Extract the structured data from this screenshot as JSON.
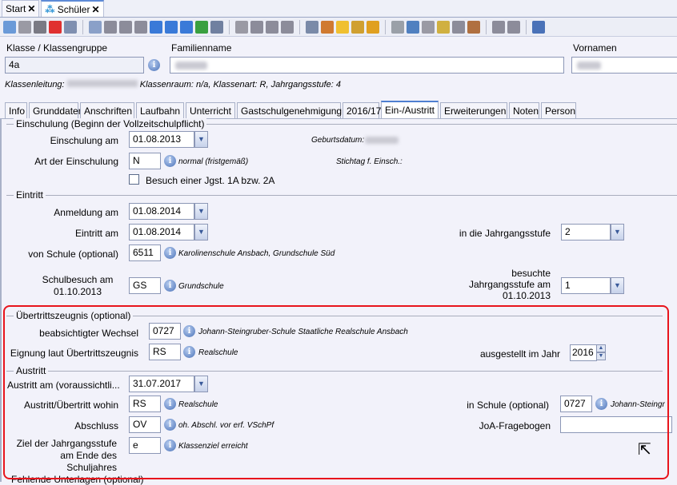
{
  "doc_tabs": [
    {
      "label": "Start"
    },
    {
      "label": "Schüler"
    }
  ],
  "toolbar_icons": [
    "new-icon",
    "save-icon",
    "undo-icon",
    "delete-icon",
    "form-icon",
    "|",
    "list-icon",
    "first-icon",
    "prev-page-icon",
    "prev-icon",
    "next-icon",
    "next-page-icon",
    "last-icon",
    "refresh-icon",
    "details-icon",
    "|",
    "back-icon",
    "cut-icon",
    "copy-icon",
    "paste-icon",
    "|",
    "print-icon",
    "view-icon",
    "tip-icon",
    "bell-icon",
    "clock-icon",
    "|",
    "export-icon",
    "user-icon",
    "tb-icon",
    "import-icon",
    "book-icon",
    "contact-icon",
    "|",
    "upload-icon",
    "download-icon",
    "|",
    "help-icon"
  ],
  "toolbar_colors": {
    "new-icon": "#6a9ad8",
    "save-icon": "#9a9aa4",
    "undo-icon": "#7a7a84",
    "delete-icon": "#e03030",
    "form-icon": "#7f8fb0",
    "list-icon": "#8aa0c8",
    "first-icon": "#8c8c9a",
    "prev-page-icon": "#8c8c9a",
    "prev-icon": "#8c8c9a",
    "next-icon": "#3a7ad8",
    "next-page-icon": "#3a7ad8",
    "last-icon": "#3a7ad8",
    "refresh-icon": "#3aa040",
    "details-icon": "#7080a0",
    "back-icon": "#9a9aa4",
    "cut-icon": "#8c8c9a",
    "copy-icon": "#8c8c9a",
    "paste-icon": "#8c8c9a",
    "print-icon": "#7a8aa8",
    "view-icon": "#d07a30",
    "tip-icon": "#f0c030",
    "bell-icon": "#d0a030",
    "clock-icon": "#e0a020",
    "export-icon": "#9aa0a8",
    "user-icon": "#5080c0",
    "tb-icon": "#9a9aa4",
    "import-icon": "#d0b040",
    "book-icon": "#8c8c9a",
    "contact-icon": "#b07040",
    "upload-icon": "#8c8c9a",
    "download-icon": "#8c8c9a",
    "help-icon": "#4a72b8"
  },
  "header": {
    "klasse_label": "Klasse / Klassengruppe",
    "klasse_value": "4a",
    "familienname_label": "Familienname",
    "vornamen_label": "Vornamen",
    "info_line_prefix": "Klassenleitung:",
    "info_line_rest": "Klassenraum: n/a, Klassenart: R, Jahrgangsstufe: 4"
  },
  "tabs": [
    {
      "label": "Info"
    },
    {
      "label": "Grunddaten"
    },
    {
      "label": "Anschriften"
    },
    {
      "label": "Laufbahn"
    },
    {
      "label": "Unterricht"
    },
    {
      "label": "Gastschulgenehmigung"
    },
    {
      "label": "2016/17"
    },
    {
      "label": "Ein-/Austritt",
      "active": true
    },
    {
      "label": "Erweiterungen"
    },
    {
      "label": "Noten"
    },
    {
      "label": "Person"
    }
  ],
  "einschulung": {
    "legend": "Einschulung (Beginn der Vollzeitschulpflicht)",
    "am_label": "Einschulung am",
    "am_value": "01.08.2013",
    "geburtsdatum_label": "Geburtsdatum:",
    "art_label": "Art der Einschulung",
    "art_value": "N",
    "art_desc": "normal (fristgemäß)",
    "stichtag_label": "Stichtag f. Einsch.:",
    "checkbox_label": "Besuch einer Jgst. 1A bzw. 2A",
    "checkbox_checked": false
  },
  "eintritt": {
    "legend": "Eintritt",
    "anmeldung_label": "Anmeldung am",
    "anmeldung_value": "01.08.2014",
    "eintritt_label": "Eintritt am",
    "eintritt_value": "01.08.2014",
    "jgst_label": "in die Jahrgangsstufe",
    "jgst_value": "2",
    "schule_label": "von Schule (optional)",
    "schule_value": "6511",
    "schule_desc": "Karolinenschule Ansbach, Grundschule Süd",
    "schulbesuch_label": "Schulbesuch am 01.10.2013",
    "schulbesuch_value": "GS",
    "schulbesuch_desc": "Grundschule",
    "besuchte_label": "besuchte Jahrgangsstufe am 01.10.2013",
    "besuchte_value": "1"
  },
  "uebertritt": {
    "legend": "Übertrittszeugnis (optional)",
    "wechsel_label": "beabsichtigter Wechsel",
    "wechsel_value": "0727",
    "wechsel_desc": "Johann-Steingruber-Schule Staatliche Realschule Ansbach",
    "eignung_label": "Eignung laut Übertrittszeugnis",
    "eignung_value": "RS",
    "eignung_desc": "Realschule",
    "jahr_label": "ausgestellt im Jahr",
    "jahr_value": "2016"
  },
  "austritt": {
    "legend": "Austritt",
    "am_label": "Austritt am (voraussichtli...",
    "am_value": "31.07.2017",
    "wohin_label": "Austritt/Übertritt wohin",
    "wohin_value": "RS",
    "wohin_desc": "Realschule",
    "schule_label": "in Schule (optional)",
    "schule_value": "0727",
    "schule_desc": "Johann-Steingrube",
    "abschluss_label": "Abschluss",
    "abschluss_value": "OV",
    "abschluss_desc": "oh. Abschl. vor erf. VSchPf",
    "joa_label": "JoA-Fragebogen",
    "joa_value": "",
    "ziel_label": "Ziel der Jahrgangsstufe am Ende des Schuljahres",
    "ziel_value": "e",
    "ziel_desc": "Klassenziel erreicht",
    "next_legend": "Fehlende Unterlagen (optional)"
  },
  "highlight_color": "#e8141c"
}
